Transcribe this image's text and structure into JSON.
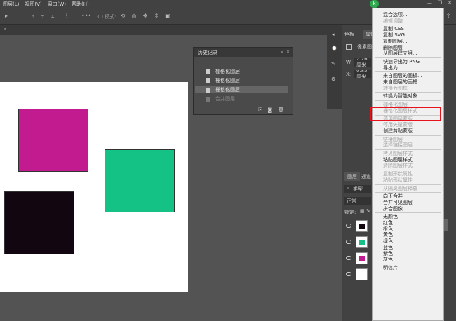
{
  "menubar": {
    "items": [
      "图层(L)",
      "视图(V)",
      "窗口(W)",
      "帮助(H)"
    ],
    "avatar_label": "k"
  },
  "options": {
    "mode_label": "3D 模式:"
  },
  "history_panel": {
    "title": "历史记录",
    "rows": [
      {
        "label": "栅格化图层",
        "selected": false,
        "dim": false
      },
      {
        "label": "栅格化图层",
        "selected": false,
        "dim": false
      },
      {
        "label": "栅格化图层",
        "selected": true,
        "dim": false
      },
      {
        "label": "合并图层",
        "selected": false,
        "dim": true
      }
    ]
  },
  "right_panels": {
    "color_tab": "色板",
    "props_tab": "属性",
    "pixel_label": "像素图层",
    "w_label": "W:",
    "w_value": "2.26 厘米",
    "x_label": "X:",
    "x_value": "0.85 厘米",
    "layers_tab": "图层",
    "channels_tab": "通道",
    "kind_label": "类型",
    "blend_label": "正常",
    "lock_label": "锁定:"
  },
  "context_menu": {
    "items": [
      {
        "label": "混合选项...",
        "disabled": false
      },
      {
        "label": "编辑调整...",
        "disabled": true
      },
      {
        "sep": true
      },
      {
        "label": "复制 CSS",
        "disabled": false
      },
      {
        "label": "复制 SVG",
        "disabled": false
      },
      {
        "label": "复制图层...",
        "disabled": false
      },
      {
        "label": "删除图层",
        "disabled": false
      },
      {
        "label": "从图层建立组...",
        "disabled": false
      },
      {
        "sep": true
      },
      {
        "label": "快速导出为 PNG",
        "disabled": false
      },
      {
        "label": "导出为...",
        "disabled": false
      },
      {
        "sep": true
      },
      {
        "label": "来自图层的画板...",
        "disabled": false
      },
      {
        "label": "来自图层的画框...",
        "disabled": false
      },
      {
        "label": "转换为图框",
        "disabled": true
      },
      {
        "sep": true
      },
      {
        "label": "转换为智能对象",
        "disabled": false
      },
      {
        "sep": true
      },
      {
        "label": "栅格化图层",
        "disabled": true
      },
      {
        "label": "栅格化图层样式",
        "disabled": true
      },
      {
        "sep": true
      },
      {
        "label": "停用图层蒙版",
        "disabled": true
      },
      {
        "label": "停用矢量蒙版",
        "disabled": true
      },
      {
        "label": "创建剪贴蒙版",
        "disabled": false
      },
      {
        "sep": true
      },
      {
        "label": "链接图层",
        "disabled": true
      },
      {
        "label": "选择链接图层",
        "disabled": true
      },
      {
        "sep": true
      },
      {
        "label": "拷贝图层样式",
        "disabled": true
      },
      {
        "label": "粘贴图层样式",
        "disabled": false
      },
      {
        "label": "清除图层样式",
        "disabled": true
      },
      {
        "sep": true
      },
      {
        "label": "复制形状属性",
        "disabled": true
      },
      {
        "label": "粘贴形状属性",
        "disabled": true
      },
      {
        "sep": true
      },
      {
        "label": "从隔离图层释放",
        "disabled": true
      },
      {
        "sep": true
      },
      {
        "label": "向下合并",
        "disabled": false
      },
      {
        "label": "合并可见图层",
        "disabled": false
      },
      {
        "label": "拼合图像",
        "disabled": false
      },
      {
        "sep": true
      },
      {
        "label": "无颜色",
        "disabled": false
      },
      {
        "label": "红色",
        "disabled": false
      },
      {
        "label": "橙色",
        "disabled": false
      },
      {
        "label": "黄色",
        "disabled": false
      },
      {
        "label": "绿色",
        "disabled": false
      },
      {
        "label": "蓝色",
        "disabled": false
      },
      {
        "label": "紫色",
        "disabled": false
      },
      {
        "label": "灰色",
        "disabled": false
      },
      {
        "sep": true
      },
      {
        "label": "明信片",
        "disabled": false
      }
    ]
  },
  "colors": {
    "magenta": "#c21a8f",
    "green": "#14c286",
    "black": "#120711",
    "highlight": "#e8121c"
  }
}
